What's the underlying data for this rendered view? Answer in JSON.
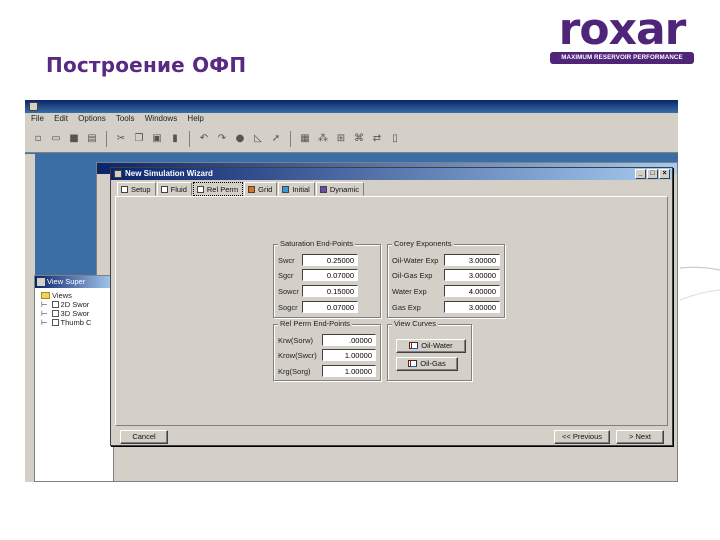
{
  "slide": {
    "title": "Построение ОФП",
    "logo_text": "roxar",
    "logo_tagline": "MAXIMUM RESERVOIR PERFORMANCE"
  },
  "app": {
    "menu": [
      "File",
      "Edit",
      "Options",
      "Tools",
      "Windows",
      "Help"
    ],
    "toolbar_icons": [
      "new-icon",
      "open-icon",
      "save-icon",
      "print-icon",
      "cut-icon",
      "copy-icon",
      "paste-icon",
      "delete-icon",
      "undo-icon",
      "redo-icon",
      "run-icon",
      "chart-icon",
      "arrow-icon",
      "grid-icon",
      "wells-icon",
      "split-icon",
      "network-icon",
      "transfer-icon",
      "trash-icon"
    ]
  },
  "tree": {
    "title": "View Super",
    "root": "Views",
    "items": [
      "2D Swor",
      "3D Swor",
      "Thumb C"
    ]
  },
  "wizard": {
    "title": "New Simulation Wizard",
    "tabs": [
      "Setup",
      "Fluid",
      "Rel Perm",
      "Grid",
      "Initial",
      "Dynamic"
    ],
    "active_tab": "Rel Perm",
    "saturation": {
      "label": "Saturation End-Points",
      "rows": [
        {
          "label": "Swcr",
          "value": "0.25000"
        },
        {
          "label": "Sgcr",
          "value": "0.07000"
        },
        {
          "label": "Sowcr",
          "value": "0.15000"
        },
        {
          "label": "Sogcr",
          "value": "0.07000"
        }
      ]
    },
    "corey": {
      "label": "Corey Exponents",
      "rows": [
        {
          "label": "Oil-Water Exp",
          "value": "3.00000"
        },
        {
          "label": "Oil-Gas Exp",
          "value": "3.00000"
        },
        {
          "label": "Water Exp",
          "value": "4.00000"
        },
        {
          "label": "Gas Exp",
          "value": "3.00000"
        }
      ]
    },
    "endpoints": {
      "label": "Rel Perm End-Points",
      "rows": [
        {
          "label": "Krw(Sorw)",
          "value": ".00000"
        },
        {
          "label": "Krow(Swcr)",
          "value": "1.00000"
        },
        {
          "label": "Krg(Sorg)",
          "value": "1.00000"
        }
      ]
    },
    "view_curves": {
      "label": "View Curves",
      "buttons": [
        "Oil-Water",
        "Oil-Gas"
      ]
    },
    "footer": {
      "cancel": "Cancel",
      "previous": "<< Previous",
      "next": "> Next"
    }
  }
}
